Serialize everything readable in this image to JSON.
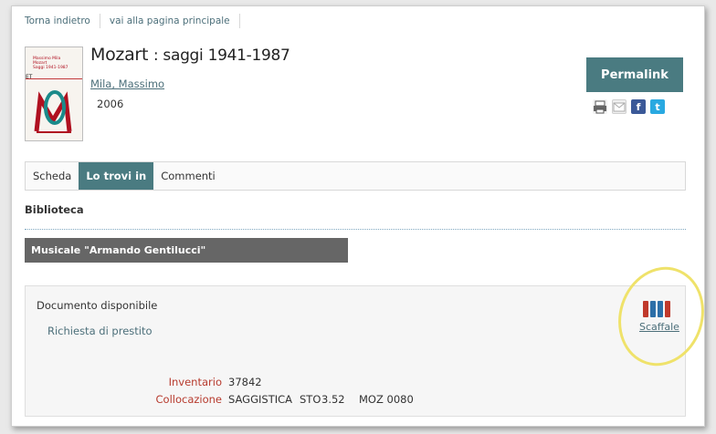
{
  "nav": {
    "back": "Torna indietro",
    "home": "vai alla pagina principale"
  },
  "cover": {
    "author": "Massimo Mila",
    "title": "Mozart",
    "subtitle": "Saggi 1941-1987",
    "line": "ET"
  },
  "record": {
    "title": "Mozart",
    "subtitle": ": saggi 1941-1987",
    "author": "Mila, Massimo",
    "year": "2006"
  },
  "actions": {
    "permalink": "Permalink",
    "share_icons": [
      "print-icon",
      "mail-icon",
      "facebook-icon",
      "twitter-icon"
    ]
  },
  "tabs": [
    {
      "label": "Scheda",
      "active": false
    },
    {
      "label": "Lo trovi in",
      "active": true
    },
    {
      "label": "Commenti",
      "active": false
    }
  ],
  "section": {
    "label": "Biblioteca",
    "library_name": "Musicale \"Armando Gentilucci\""
  },
  "availability": {
    "status": "Documento disponibile",
    "loan_link": "Richiesta di prestito",
    "shelf_label": "Scaffale",
    "inventory_label": "Inventario",
    "inventory_value": "37842",
    "location_label": "Collocazione",
    "location_parts": [
      "SAGGISTICA",
      "STO",
      "3.52",
      "MOZ 0080"
    ]
  },
  "colors": {
    "accent": "#4a7b81",
    "library_bar": "#666666",
    "label_red": "#b73b2e",
    "link": "#4c6f7a",
    "highlight": "#efe26a",
    "shelf": [
      "#c0392b",
      "#2c6fa8",
      "#2c6fa8",
      "#c0392b"
    ]
  }
}
